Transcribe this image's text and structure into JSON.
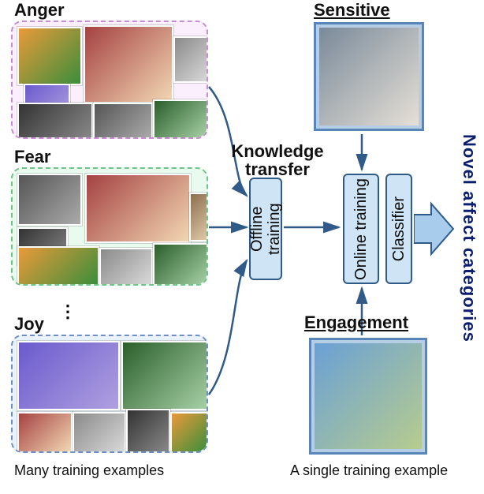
{
  "categories": {
    "anger": {
      "label": "Anger"
    },
    "fear": {
      "label": "Fear"
    },
    "joy": {
      "label": "Joy"
    }
  },
  "single_examples": {
    "sensitive": {
      "label": "Sensitive"
    },
    "engagement": {
      "label": "Engagement"
    }
  },
  "center_label_line1": "Knowledge",
  "center_label_line2": "transfer",
  "flow": {
    "offline_training": "Offline training",
    "online_training": "Online training",
    "classifier": "Classifier"
  },
  "output_label": "Novel affect categories",
  "bottom_left": "Many training examples",
  "bottom_right": "A single training example",
  "colors": {
    "anger_border": "#c48ed0",
    "fear_border": "#6fc48c",
    "joy_border": "#6f8fc4",
    "flow_fill": "#cfe4f5",
    "flow_border": "#305a87",
    "arrow": "#305a87",
    "big_arrow": "#6fa8dc",
    "output_text": "#0b1e6e"
  }
}
